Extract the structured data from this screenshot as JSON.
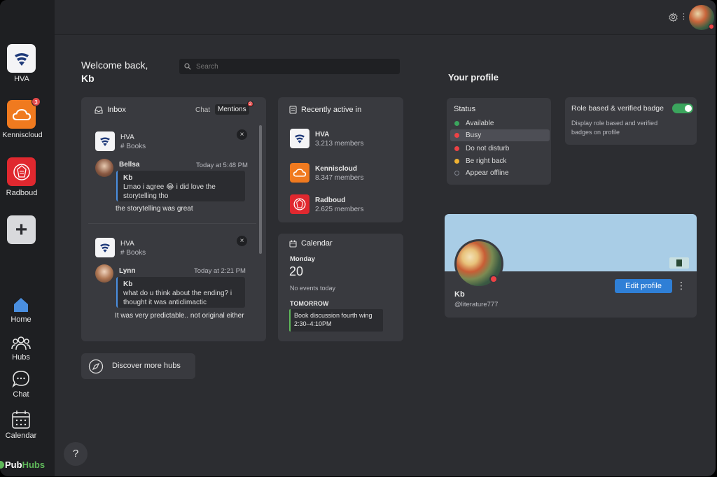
{
  "sidebar": {
    "hubs": [
      {
        "label": "HVA",
        "color": "#f4f4f6"
      },
      {
        "label": "Kenniscloud",
        "color": "#f07a1f",
        "badge": "3"
      },
      {
        "label": "Radboud",
        "color": "#e0282f"
      }
    ],
    "add_label": "+",
    "nav": [
      {
        "label": "Home"
      },
      {
        "label": "Hubs"
      },
      {
        "label": "Chat"
      },
      {
        "label": "Calendar"
      }
    ],
    "brand": {
      "prefix": "Pub",
      "suffix": "Hubs"
    },
    "help_label": "?"
  },
  "topbar": {
    "more_label": "⋮"
  },
  "welcome": {
    "line1": "Welcome back,",
    "line2": "Kb"
  },
  "search": {
    "placeholder": "Search"
  },
  "inbox": {
    "title": "Inbox",
    "tab_chat": "Chat",
    "tab_mentions": "Mentions",
    "mentions_badge": "2",
    "threads": [
      {
        "hub": "HVA",
        "room": "# Books",
        "author": "Bellsa",
        "time": "Today at 5:48 PM",
        "quote_author": "Kb",
        "quote_text": "Lmao i agree 😂 i did love the storytelling tho",
        "reply": "the storytelling was great"
      },
      {
        "hub": "HVA",
        "room": "# Books",
        "author": "Lynn",
        "time": "Today at 2:21 PM",
        "quote_author": "Kb",
        "quote_text": "what do u think about the ending? i thought it was anticlimactic",
        "reply": "It was very predictable.. not original either"
      }
    ],
    "close_label": "×"
  },
  "discover": {
    "label": "Discover more hubs"
  },
  "recent": {
    "title": "Recently active in",
    "hubs": [
      {
        "name": "HVA",
        "members": "3.213 members"
      },
      {
        "name": "Kenniscloud",
        "members": "8.347 members"
      },
      {
        "name": "Radboud",
        "members": "2.625 members"
      }
    ]
  },
  "calendar": {
    "title": "Calendar",
    "day": "Monday",
    "date": "20",
    "no_events": "No events today",
    "tomorrow": "TOMORROW",
    "event_title": "Book discussion fourth wing",
    "event_time": "2:30–4:10PM"
  },
  "profile": {
    "section_title": "Your profile",
    "status": {
      "title": "Status",
      "options": [
        {
          "label": "Available",
          "color": "#3ba55d"
        },
        {
          "label": "Busy",
          "color": "#ed4245"
        },
        {
          "label": "Do not disturb",
          "color": "#ed4245"
        },
        {
          "label": "Be right back",
          "color": "#f0b232"
        },
        {
          "label": "Appear offline",
          "color": "#80848e"
        }
      ]
    },
    "badge": {
      "title": "Role based & verified badge",
      "description": "Display role based and verified badges on profile"
    },
    "name": "Kb",
    "handle": "@literature777",
    "edit_label": "Edit profile",
    "more_label": "⋮"
  }
}
